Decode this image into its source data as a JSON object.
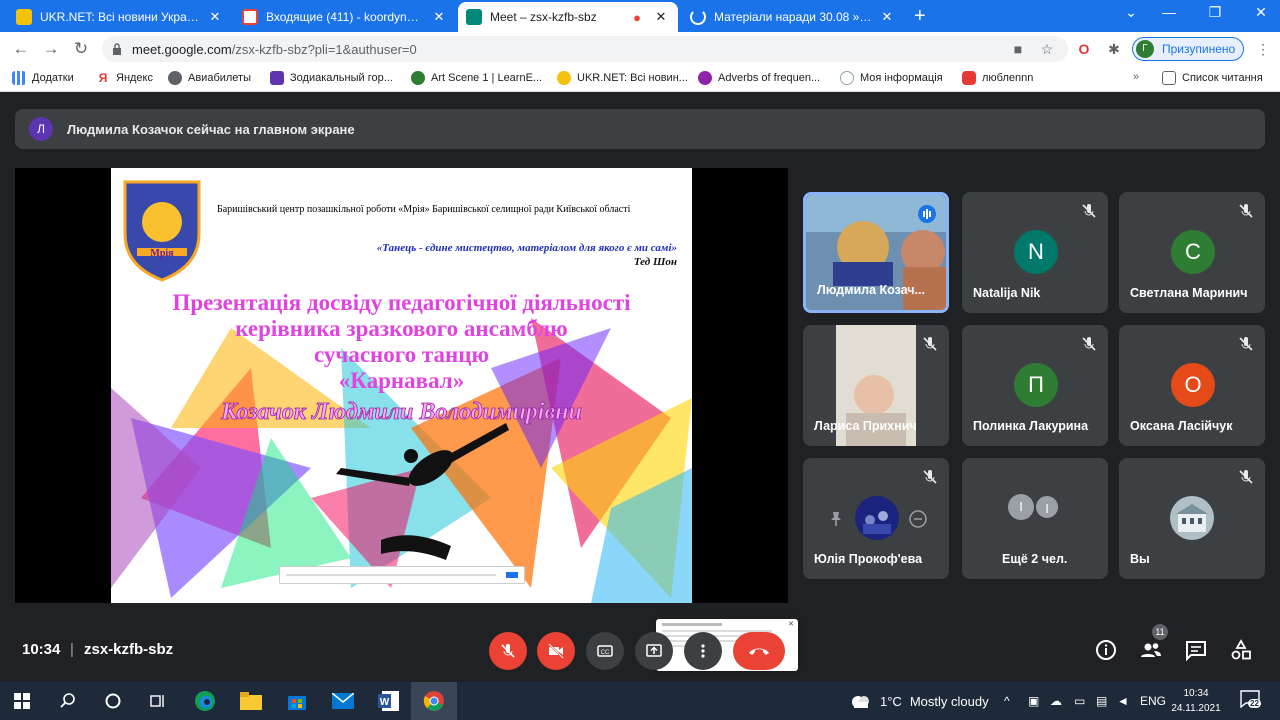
{
  "browser": {
    "tabs": [
      {
        "label": "UKR.NET: Всі новини України, ос",
        "icon": "ukrnet-favicon",
        "active": false
      },
      {
        "label": "Входящие (411) - koordynatzia@",
        "icon": "gmail-favicon",
        "active": false
      },
      {
        "label": "Meet – zsx-kzfb-sbz",
        "icon": "meet-favicon",
        "active": true
      },
      {
        "label": "Матеріали наради 30.08 » КНЗ \"",
        "icon": "loading-favicon",
        "active": false
      }
    ],
    "url_host": "meet.google.com",
    "url_path": "/zsx-kzfb-sbz?pli=1&authuser=0",
    "profile_letter": "Г",
    "profile_status": "Призупинено",
    "bookmarks": [
      "Додатки",
      "Яндекс",
      "Авиабилеты",
      "Зодиакальный гор...",
      "Art Scene 1 | LearnE...",
      "UKR.NET: Всі новин...",
      "Adverbs of frequen...",
      "Моя інформація",
      "люблennn"
    ],
    "reading_list": "Список читання"
  },
  "meet": {
    "presenter_initial": "Л",
    "presenter_notice": "Людмила Козачок сейчас на главном экране",
    "slide": {
      "org": "Баришівський центр позашкільної роботи «Мрія» Баришівської селищної ради Київської області",
      "quote": "«Танець - єдине мистецтво, матеріалом для якого є ми самі»",
      "author": "Тед Шон",
      "title_lines": [
        "Презентація  досвіду педагогічної діяльності",
        "керівника зразкового ансамблю",
        "сучасного танцю",
        "«Карнавал»"
      ],
      "name": "Козачок Людмили Володимирівни",
      "logo_text": "Мрія"
    },
    "participants": [
      {
        "name": "Людмила Козач...",
        "initial": "",
        "color": ""
      },
      {
        "name": "Natalija Nik",
        "initial": "N",
        "color": "#00796b"
      },
      {
        "name": "Светлана Маринич",
        "initial": "С",
        "color": "#2e7d32"
      },
      {
        "name": "Лариса Прихнич",
        "initial": "",
        "color": ""
      },
      {
        "name": "Полинка Лакурина",
        "initial": "П",
        "color": "#2e7d32"
      },
      {
        "name": "Оксана Ласійчук",
        "initial": "О",
        "color": "#e64a19"
      },
      {
        "name": "Юлія Прокоф'ева",
        "initial": "",
        "color": ""
      },
      {
        "name": "Ещё 2 чел.",
        "initial": "",
        "color": ""
      },
      {
        "name": "Вы",
        "initial": "",
        "color": ""
      }
    ],
    "more_initials": [
      "I",
      "I"
    ],
    "time": "10:34",
    "separator": "|",
    "meeting_code": "zsx-kzfb-sbz",
    "participant_count": "11"
  },
  "taskbar": {
    "temperature": "1°C",
    "weather": "Mostly cloudy",
    "language": "ENG",
    "time": "10:34",
    "date": "24.11.2021",
    "notifications": "22"
  },
  "colors": {
    "tab_bar": "#1a73e8",
    "meet_bg": "#202124",
    "tile_bg": "#3c4043",
    "danger": "#ea4335"
  }
}
